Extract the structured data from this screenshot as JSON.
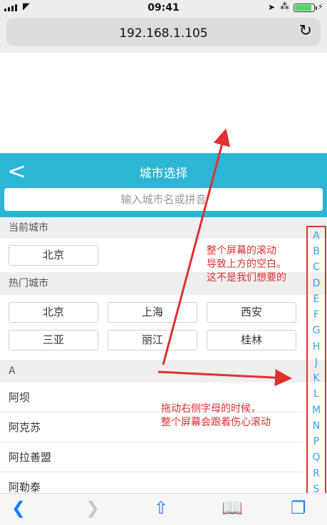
{
  "status_bar": {
    "time": "09:41",
    "battery_level": 0.9
  },
  "browser": {
    "url": "192.168.1.105"
  },
  "header": {
    "back_label": "<",
    "title": "城市选择"
  },
  "search": {
    "placeholder": "输入城市名或拼音"
  },
  "sections": {
    "current": {
      "title": "当前城市",
      "cities": [
        "北京"
      ]
    },
    "hot": {
      "title": "热门城市",
      "cities": [
        "北京",
        "上海",
        "西安",
        "三亚",
        "丽江",
        "桂林"
      ]
    },
    "a": {
      "title": "A",
      "cities": [
        "阿坝",
        "阿克苏",
        "阿拉善盟",
        "阿勒泰"
      ]
    }
  },
  "alphabet_index": [
    "A",
    "B",
    "C",
    "D",
    "E",
    "F",
    "G",
    "H",
    "J",
    "K",
    "L",
    "M",
    "N",
    "P",
    "Q",
    "R",
    "S"
  ],
  "annotations": {
    "top": [
      "整个屏幕的滚动",
      "导致上方的空白。",
      "这不是我们想要的"
    ],
    "bottom": [
      "拖动右侧字母的时候，",
      "整个屏幕会跟着伤心滚动"
    ]
  },
  "colors": {
    "header": "#2db5d5",
    "index_letters": "#3a9fe0",
    "annotation": "#e03030",
    "safari_tint": "#1a7cf5"
  },
  "toolbar": [
    "back-icon",
    "forward-icon",
    "share-icon",
    "bookmarks-icon",
    "tabs-icon"
  ]
}
